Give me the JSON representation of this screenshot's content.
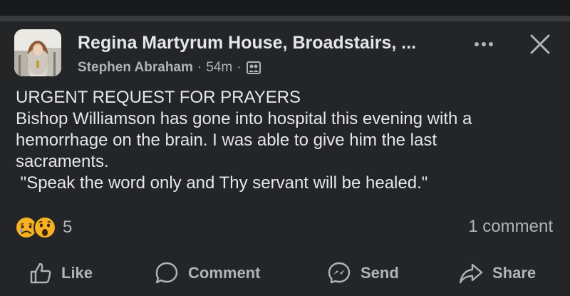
{
  "post": {
    "page_name": "Regina Martyrum House, Broadstairs, ...",
    "author": "Stephen Abraham",
    "time": "54m",
    "separator": "·",
    "body_lines": [
      "URGENT REQUEST FOR PRAYERS",
      "Bishop Williamson has gone into hospital this evening with a",
      "hemorrhage on the brain. I was able to give him the last",
      "sacraments.",
      " \"Speak the word only and Thy servant will be healed.\""
    ],
    "reaction_count": "5",
    "comment_count": "1 comment",
    "reaction_icons": [
      "sad-reaction-icon",
      "wow-reaction-icon"
    ]
  },
  "actions": {
    "like": "Like",
    "comment": "Comment",
    "send": "Send",
    "share": "Share"
  },
  "colors": {
    "background": "#242526",
    "text": "#e4e6eb",
    "secondary": "#b0b3b8",
    "reaction_yellow": "#f7b125"
  }
}
